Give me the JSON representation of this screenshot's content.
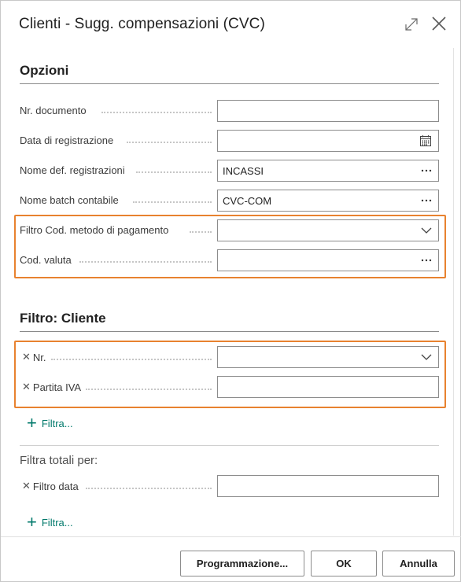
{
  "dialog": {
    "title": "Clienti - Sugg. compensazioni (CVC)"
  },
  "options": {
    "section_title": "Opzioni",
    "fields": [
      {
        "label": "Nr. documento",
        "value": ""
      },
      {
        "label": "Data di registrazione",
        "value": "",
        "icon": "calendar-icon"
      },
      {
        "label": "Nome def. registrazioni",
        "value": "INCASSI",
        "icon": "ellipsis-icon"
      },
      {
        "label": "Nome batch contabile",
        "value": "CVC-COM",
        "icon": "ellipsis-icon"
      },
      {
        "label": "Filtro Cod. metodo di pagamento",
        "value": "",
        "icon": "chevron-down-icon"
      },
      {
        "label": "Cod. valuta",
        "value": "",
        "icon": "ellipsis-icon"
      }
    ]
  },
  "filter_customer": {
    "section_title": "Filtro: Cliente",
    "fields": [
      {
        "label": "Nr.",
        "value": "",
        "icon": "chevron-down-icon"
      },
      {
        "label": "Partita IVA",
        "value": ""
      }
    ],
    "add_filter_label": "Filtra..."
  },
  "totals_filter": {
    "title": "Filtra totali per:",
    "fields": [
      {
        "label": "Filtro data",
        "value": ""
      }
    ],
    "add_filter_label": "Filtra..."
  },
  "footer": {
    "schedule_label": "Programmazione...",
    "ok_label": "OK",
    "cancel_label": "Annulla"
  },
  "colors": {
    "highlight": "#e8822f",
    "accent": "#00796b"
  }
}
